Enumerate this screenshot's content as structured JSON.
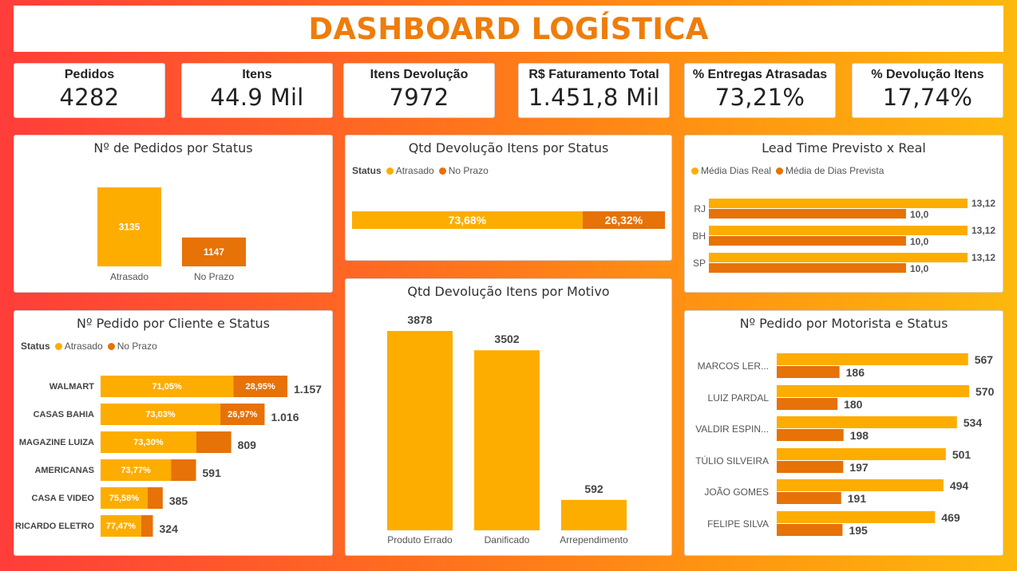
{
  "title": "DASHBOARD LOGÍSTICA",
  "kpis": [
    {
      "label": "Pedidos",
      "value": "4282"
    },
    {
      "label": "Itens",
      "value": "44.9 Mil"
    },
    {
      "label": "Itens Devolução",
      "value": "7972"
    },
    {
      "label": "R$ Faturamento Total",
      "value": "1.451,8 Mil"
    },
    {
      "label": "% Entregas Atrasadas",
      "value": "73,21%"
    },
    {
      "label": "% Devolução Itens",
      "value": "17,74%"
    }
  ],
  "colors": {
    "atrasado": "#fdad00",
    "no_prazo": "#e67208"
  },
  "legend": {
    "status": "Status",
    "atrasado": "Atrasado",
    "no_prazo": "No Prazo",
    "media_real": "Média Dias Real",
    "media_prevista": "Média de Dias Prevista"
  },
  "chart_data": [
    {
      "id": "pedidos_status",
      "type": "bar",
      "title": "Nº de Pedidos por Status",
      "categories": [
        "Atrasado",
        "No Prazo"
      ],
      "values": [
        3135,
        1147
      ],
      "value_labels": [
        "3135",
        "1147"
      ]
    },
    {
      "id": "devolucao_status",
      "type": "bar",
      "orientation": "horizontal-stacked-100",
      "title": "Qtd Devolução Itens por Status",
      "series": [
        {
          "name": "Atrasado",
          "value": 73.68,
          "label": "73,68%"
        },
        {
          "name": "No Prazo",
          "value": 26.32,
          "label": "26,32%"
        }
      ]
    },
    {
      "id": "lead_time",
      "type": "bar",
      "orientation": "horizontal-grouped",
      "title": "Lead Time Previsto x Real",
      "categories": [
        "RJ",
        "BH",
        "SP"
      ],
      "series": [
        {
          "name": "Média Dias Real",
          "values": [
            13.12,
            13.12,
            13.12
          ],
          "labels": [
            "13,12",
            "13,12",
            "13,12"
          ]
        },
        {
          "name": "Média de Dias Prevista",
          "values": [
            10.0,
            10.0,
            10.0
          ],
          "labels": [
            "10,0",
            "10,0",
            "10,0"
          ]
        }
      ]
    },
    {
      "id": "devolucao_motivo",
      "type": "bar",
      "title": "Qtd Devolução Itens por Motivo",
      "categories": [
        "Produto Errado",
        "Danificado",
        "Arrependimento"
      ],
      "values": [
        3878,
        3502,
        592
      ],
      "value_labels": [
        "3878",
        "3502",
        "592"
      ]
    },
    {
      "id": "cliente_status",
      "type": "bar",
      "orientation": "horizontal-stacked",
      "title": "Nº Pedido por Cliente e Status",
      "categories": [
        "WALMART",
        "CASAS BAHIA",
        "MAGAZINE LUIZA",
        "AMERICANAS",
        "CASA E VIDEO",
        "RICARDO ELETRO"
      ],
      "totals": [
        1157,
        1016,
        809,
        591,
        385,
        324
      ],
      "total_labels": [
        "1.157",
        "1.016",
        "809",
        "591",
        "385",
        "324"
      ],
      "atrasado_pct": [
        71.05,
        73.03,
        73.3,
        73.77,
        75.58,
        77.47
      ],
      "atrasado_labels": [
        "71,05%",
        "73,03%",
        "73,30%",
        "73,77%",
        "75,58%",
        "77,47%"
      ],
      "no_prazo_labels": [
        "28,95%",
        "26,97%",
        "",
        "",
        "",
        ""
      ]
    },
    {
      "id": "motorista_status",
      "type": "bar",
      "orientation": "horizontal-grouped",
      "title": "Nº Pedido por Motorista e Status",
      "categories": [
        "MARCOS LER...",
        "LUIZ PARDAL",
        "VALDIR ESPIN...",
        "TÚLIO SILVEIRA",
        "JOÃO GOMES",
        "FELIPE SILVA"
      ],
      "series": [
        {
          "name": "Atrasado",
          "values": [
            567,
            570,
            534,
            501,
            494,
            469
          ]
        },
        {
          "name": "No Prazo",
          "values": [
            186,
            180,
            198,
            197,
            191,
            195
          ]
        }
      ]
    }
  ]
}
